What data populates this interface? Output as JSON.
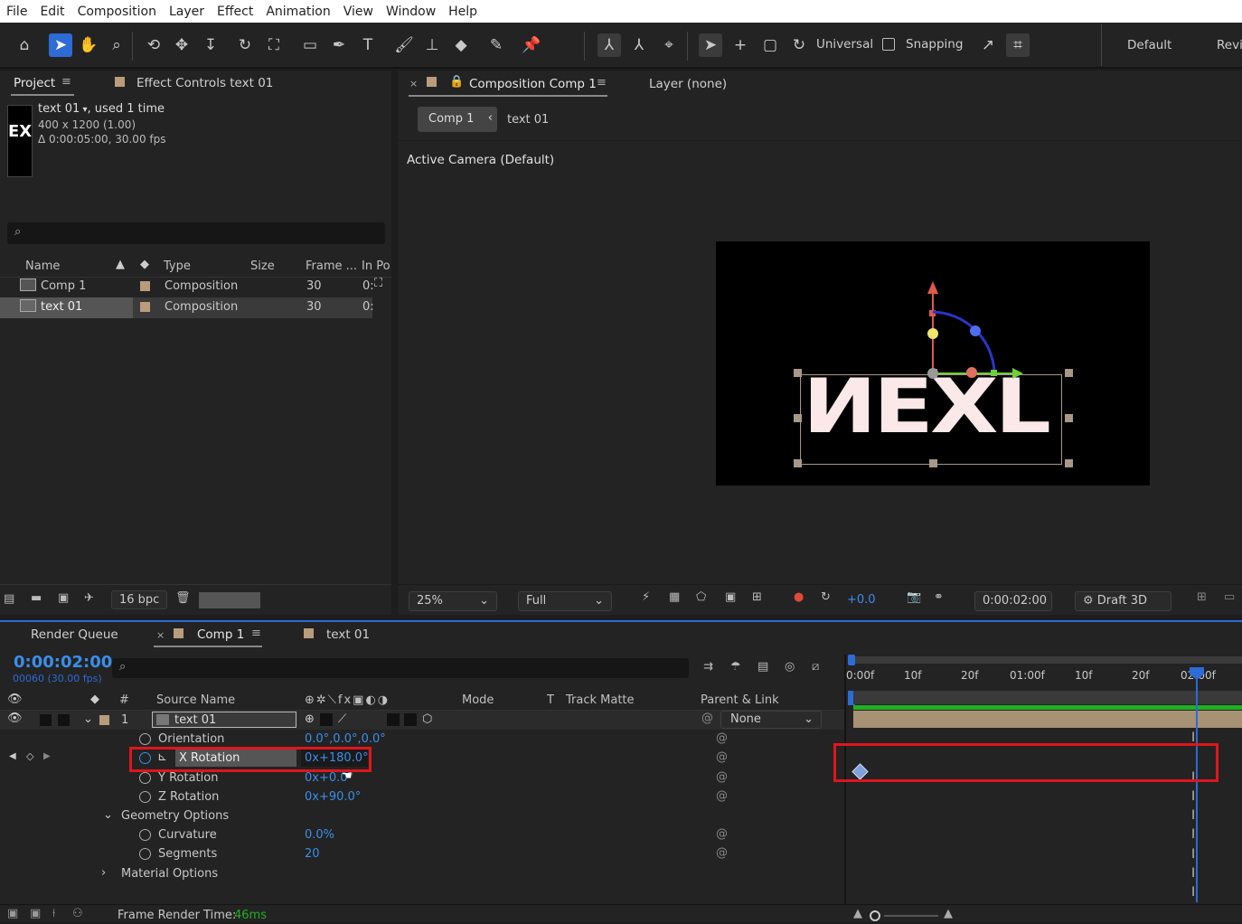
{
  "menu": [
    "File",
    "Edit",
    "Composition",
    "Layer",
    "Effect",
    "Animation",
    "View",
    "Window",
    "Help"
  ],
  "toolbar": {
    "universal": "Universal",
    "snapping": "Snapping",
    "workspace_default": "Default",
    "workspace_review": "Revi"
  },
  "project": {
    "tab": "Project",
    "effect_tab": "Effect Controls text 01",
    "thumb_text": "EX",
    "item_name": "text 01",
    "used": ", used 1 time",
    "dims": "400 x 1200 (1.00)",
    "duration": "Δ 0:00:05:00, 30.00 fps",
    "columns": [
      "Name",
      "Type",
      "Size",
      "Frame ...",
      "In Po"
    ],
    "rows": [
      {
        "name": "Comp 1",
        "type": "Composition",
        "frame": "30",
        "in": "0:"
      },
      {
        "name": "text 01",
        "type": "Composition",
        "frame": "30",
        "in": "0:"
      }
    ],
    "bpc": "16 bpc"
  },
  "composition": {
    "tab": "Composition Comp 1",
    "layer_tab": "Layer (none)",
    "crumb_comp": "Comp 1",
    "crumb_layer": "text 01",
    "camera": "Active Camera (Default)",
    "canvas_text": "ИEXL"
  },
  "viewer_footer": {
    "zoom": "25%",
    "resolution": "Full",
    "exposure": "+0.0",
    "timecode": "0:00:02:00",
    "renderer": "Draft 3D"
  },
  "timeline": {
    "tabs": [
      "Render Queue",
      "Comp 1",
      "text 01"
    ],
    "timecode": "0:00:02:00",
    "frames": "00060 (30.00 fps)",
    "col_num": "#",
    "col_source": "Source Name",
    "col_mode": "Mode",
    "col_t": "T",
    "col_matte": "Track Matte",
    "col_parent": "Parent & Link",
    "layer_num": "1",
    "layer_name": "text 01",
    "parent": "None",
    "props": [
      {
        "name": "Orientation",
        "value": "0.0°,0.0°,0.0°"
      },
      {
        "name": "X Rotation",
        "value": "0x+180.0°"
      },
      {
        "name": "Y Rotation",
        "value": "0x+0.0°"
      },
      {
        "name": "Z Rotation",
        "value": "0x+90.0°"
      },
      {
        "name": "Geometry Options",
        "value": ""
      },
      {
        "name": "Curvature",
        "value": "0.0%"
      },
      {
        "name": "Segments",
        "value": "20"
      },
      {
        "name": "Material Options",
        "value": ""
      }
    ],
    "ruler": [
      "0:00f",
      "10f",
      "20f",
      "01:00f",
      "10f",
      "20f",
      "02:00f"
    ],
    "render_label": "Frame Render Time:",
    "render_time": "46ms"
  },
  "colors": {
    "accent": "#2d6bd6",
    "highlight": "#e0151d",
    "value_blue": "#3b8eea"
  }
}
